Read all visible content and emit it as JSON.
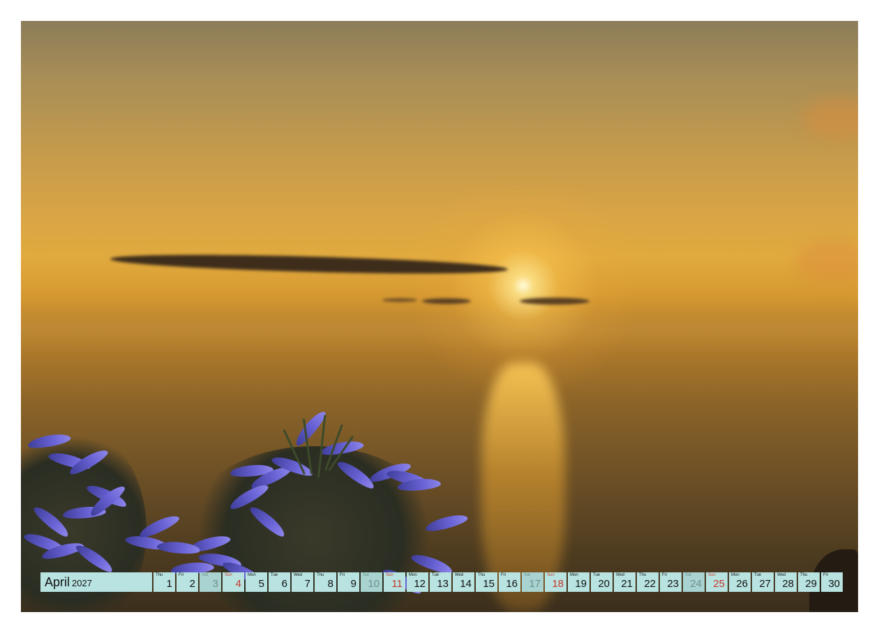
{
  "calendar": {
    "month": "April",
    "year": "2027",
    "colors": {
      "cell_background": "#b8e3e0",
      "weekend_background": "#a8d3d0",
      "sunday_text": "#c8352b",
      "saturday_text": "#6f8f8c"
    },
    "days": [
      {
        "weekday": "Thu",
        "day": "1",
        "type": "weekday"
      },
      {
        "weekday": "Fri",
        "day": "2",
        "type": "weekday"
      },
      {
        "weekday": "Sat",
        "day": "3",
        "type": "sat"
      },
      {
        "weekday": "Sun",
        "day": "4",
        "type": "sun"
      },
      {
        "weekday": "Mon",
        "day": "5",
        "type": "weekday"
      },
      {
        "weekday": "Tue",
        "day": "6",
        "type": "weekday"
      },
      {
        "weekday": "Wed",
        "day": "7",
        "type": "weekday"
      },
      {
        "weekday": "Thu",
        "day": "8",
        "type": "weekday"
      },
      {
        "weekday": "Fri",
        "day": "9",
        "type": "weekday"
      },
      {
        "weekday": "Sat",
        "day": "10",
        "type": "sat"
      },
      {
        "weekday": "Sun",
        "day": "11",
        "type": "sun"
      },
      {
        "weekday": "Mon",
        "day": "12",
        "type": "weekday"
      },
      {
        "weekday": "Tue",
        "day": "13",
        "type": "weekday"
      },
      {
        "weekday": "Wed",
        "day": "14",
        "type": "weekday"
      },
      {
        "weekday": "Thu",
        "day": "15",
        "type": "weekday"
      },
      {
        "weekday": "Fri",
        "day": "16",
        "type": "weekday"
      },
      {
        "weekday": "Sat",
        "day": "17",
        "type": "sat"
      },
      {
        "weekday": "Sun",
        "day": "18",
        "type": "sun"
      },
      {
        "weekday": "Mon",
        "day": "19",
        "type": "weekday"
      },
      {
        "weekday": "Tue",
        "day": "20",
        "type": "weekday"
      },
      {
        "weekday": "Wed",
        "day": "21",
        "type": "weekday"
      },
      {
        "weekday": "Thu",
        "day": "22",
        "type": "weekday"
      },
      {
        "weekday": "Fri",
        "day": "23",
        "type": "weekday"
      },
      {
        "weekday": "Sat",
        "day": "24",
        "type": "sat"
      },
      {
        "weekday": "Sun",
        "day": "25",
        "type": "sun"
      },
      {
        "weekday": "Mon",
        "day": "26",
        "type": "weekday"
      },
      {
        "weekday": "Tue",
        "day": "27",
        "type": "weekday"
      },
      {
        "weekday": "Wed",
        "day": "28",
        "type": "weekday"
      },
      {
        "weekday": "Thu",
        "day": "29",
        "type": "weekday"
      },
      {
        "weekday": "Fri",
        "day": "30",
        "type": "weekday"
      }
    ]
  }
}
